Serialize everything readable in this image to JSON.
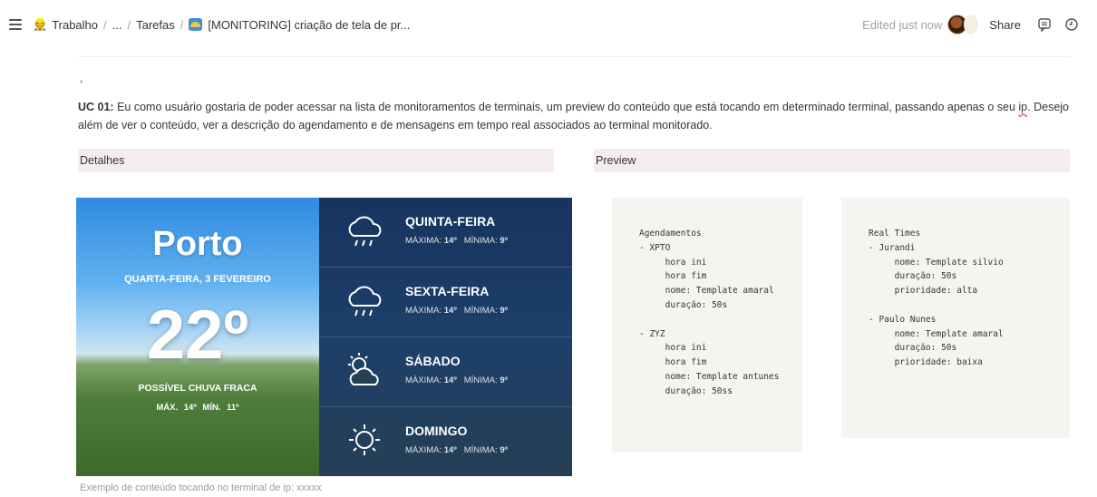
{
  "topbar": {
    "breadcrumb": [
      "Trabalho",
      "...",
      "Tarefas",
      "[MONITORING] criação de tela de pr..."
    ],
    "edited": "Edited just now",
    "share": "Share"
  },
  "doc": {
    "tick": ",",
    "uc_label": "UC 01:",
    "uc_text_1": " Eu como usuário gostaria de poder acessar na lista de monitoramentos de terminais, um preview do conteúdo que está tocando em determinado terminal, passando apenas o seu ",
    "uc_ip": "ip",
    "uc_text_2": ". Desejo além de ver o conteúdo, ver a descrição do agendamento e de mensagens em tempo real associados ao terminal monitorado.",
    "col_detalhes": "Detalhes",
    "col_preview": "Preview",
    "caption": "Exemplo de conteúdo tocando no terminal de ip: xxxxx"
  },
  "weather": {
    "city": "Porto",
    "date": "QUARTA-FEIRA, 3 FEVEREIRO",
    "temp": "22º",
    "condition": "POSSÍVEL CHUVA FRACA",
    "minmax": "MÁX. 14º   MÍN. 11º",
    "days": [
      {
        "name": "QUINTA-FEIRA",
        "max_label": "MÁXIMA:",
        "max": "14º",
        "min_label": "MÍNIMA:",
        "min": "9º",
        "icon": "rain-cloud-icon"
      },
      {
        "name": "SEXTA-FEIRA",
        "max_label": "MÁXIMA:",
        "max": "14º",
        "min_label": "MÍNIMA:",
        "min": "9º",
        "icon": "rain-cloud-icon"
      },
      {
        "name": "SÁBADO",
        "max_label": "MÁXIMA:",
        "max": "14º",
        "min_label": "MÍNIMA:",
        "min": "9º",
        "icon": "partly-sunny-icon"
      },
      {
        "name": "DOMINGO",
        "max_label": "MÁXIMA:",
        "max": "14º",
        "min_label": "MÍNIMA:",
        "min": "9º",
        "icon": "sun-icon"
      }
    ]
  },
  "code_blocks": {
    "agendamentos": "Agendamentos\n- XPTO\n     hora ini\n     hora fim\n     nome: Template amaral\n     duração: 50s\n\n- ZYZ\n     hora ini\n     hora fim\n     nome: Template antunes\n     duração: 50ss",
    "realtimes": "Real Times\n- Jurandi\n     nome: Template silvio\n     duração: 50s\n     prioridade: alta\n\n- Paulo Nunes\n     nome: Template amaral\n     duração: 50s\n     prioridade: baixa"
  }
}
